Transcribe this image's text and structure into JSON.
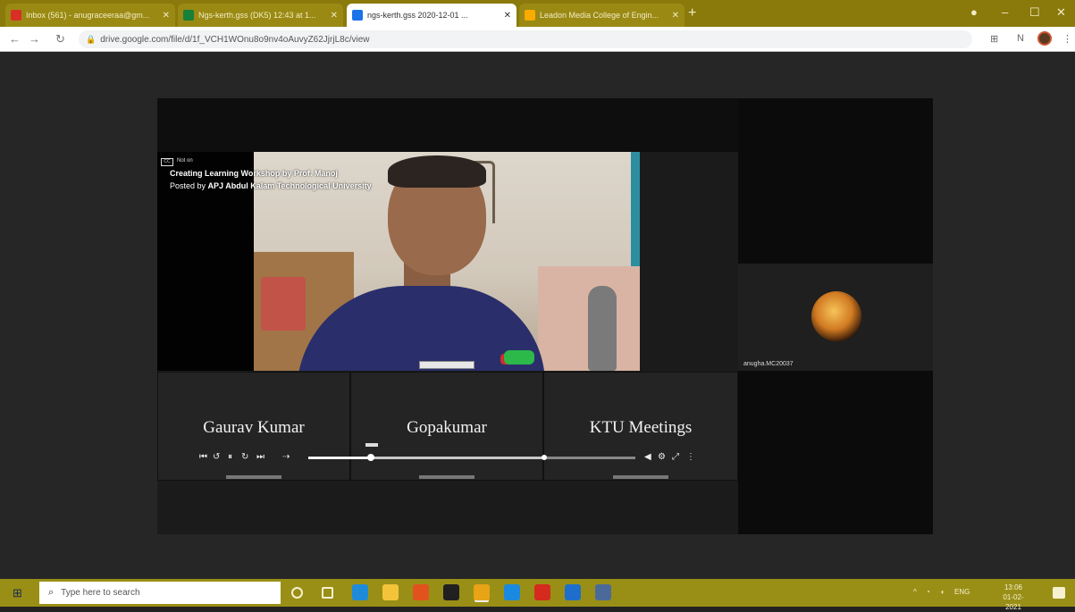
{
  "browser": {
    "tabs": [
      {
        "label": "Inbox (561) - anugraceeraa@gm...",
        "favicon_color": "#d93025",
        "active": false
      },
      {
        "label": "Ngs-kerth.gss (DK5) 12:43 at 1...",
        "favicon_color": "#188038",
        "active": false
      },
      {
        "label": "ngs-kerth.gss 2020-12-01 ...",
        "favicon_color": "#1a73e8",
        "active": true
      },
      {
        "label": "Leadon Media College of Engin...",
        "favicon_color": "#f9ab00",
        "active": false
      }
    ],
    "new_tab_icon": "plus-icon",
    "url": "drive.google.com/file/d/1f_VCH1WOnu8o9nv4oAuvyZ62JjrjL8c/view",
    "extension_badge": "N"
  },
  "video": {
    "overlay_logo": "CC",
    "overlay_logo_text": "Not on",
    "title": "Creating Learning Workshop by Prof. Manoj",
    "posted_prefix": "Posted by",
    "posted_by": "APJ Abdul Kalam Technological University"
  },
  "participants": [
    {
      "name": "Gaurav Kumar"
    },
    {
      "name": "Gopakumar"
    },
    {
      "name": "KTU Meetings"
    }
  ],
  "side_participant": {
    "name": "anugha.MC20037"
  },
  "player": {
    "progress": 0.19,
    "buffered": 0.72,
    "icons": [
      "prev-icon",
      "rewind-icon",
      "pause-icon",
      "forward-icon",
      "next-icon"
    ]
  },
  "taskbar": {
    "search_placeholder": "Type here to search",
    "tray_lang": "ENG",
    "time": "13:06",
    "date": "01-02-2021",
    "apps": [
      {
        "name": "cortana-icon",
        "color": "#f6f1cf"
      },
      {
        "name": "task-view-icon",
        "color": "#f6f1cf"
      },
      {
        "name": "edge-icon",
        "color": "#1f8bd8"
      },
      {
        "name": "file-explorer-icon",
        "color": "#f3c43a"
      },
      {
        "name": "office-icon",
        "color": "#e2521d"
      },
      {
        "name": "app-icon-a",
        "color": "#202020"
      },
      {
        "name": "chrome-icon",
        "color": "#e8a317"
      },
      {
        "name": "store-icon",
        "color": "#1a8ae0"
      },
      {
        "name": "pdf-icon",
        "color": "#d52a1e"
      },
      {
        "name": "mail-icon",
        "color": "#1e6fcb"
      },
      {
        "name": "settings-icon",
        "color": "#4b6a9a"
      }
    ]
  }
}
